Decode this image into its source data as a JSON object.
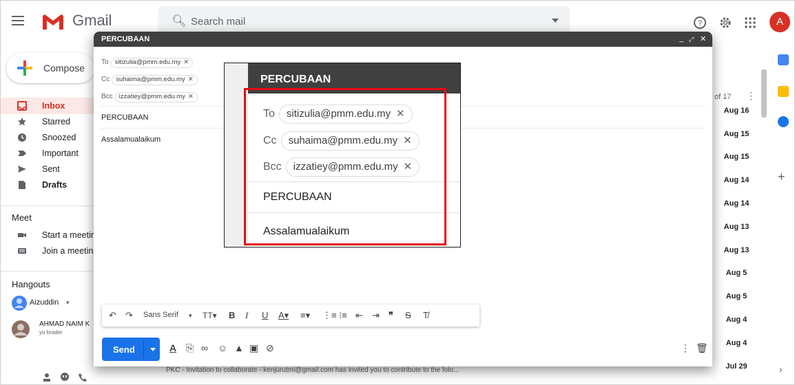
{
  "app": {
    "name": "Gmail"
  },
  "search": {
    "placeholder": "Search mail"
  },
  "user": {
    "avatar_letter": "A"
  },
  "sidebar": {
    "compose_label": "Compose",
    "items": [
      {
        "label": "Inbox",
        "icon": "inbox-icon"
      },
      {
        "label": "Starred",
        "icon": "star-icon"
      },
      {
        "label": "Snoozed",
        "icon": "clock-icon"
      },
      {
        "label": "Important",
        "icon": "important-icon"
      },
      {
        "label": "Sent",
        "icon": "send-icon"
      },
      {
        "label": "Drafts",
        "icon": "draft-icon"
      }
    ],
    "meet_title": "Meet",
    "meet_items": [
      "Start a meetin",
      "Join a meetin"
    ],
    "hangouts_title": "Hangouts",
    "hangouts_user": "Aizuddin",
    "contact_name": "AHMAD NAIM K",
    "contact_status": "yo brader"
  },
  "list": {
    "pager": "of 17",
    "dates": [
      "Aug 16",
      "Aug 15",
      "Aug 15",
      "Aug 14",
      "Aug 14",
      "Aug 13",
      "Aug 13",
      "Aug 5",
      "Aug 5",
      "Aug 4",
      "Aug 4",
      "Jul 29"
    ],
    "peek_text": "PKC - Invitation to collaborate - kenjurutmi@gmail.com has invited you to contribute to the folo..."
  },
  "compose": {
    "title": "PERCUBAAN",
    "to_label": "To",
    "cc_label": "Cc",
    "bcc_label": "Bcc",
    "to": "sitizulia@pmm.edu.my",
    "cc": "suhaima@pmm.edu.my",
    "bcc": "izzatiey@pmm.edu.my",
    "subject": "PERCUBAAN",
    "body": "Assalamualaikum",
    "font_select": "Sans Serif",
    "send_label": "Send"
  },
  "zoom": {
    "title": "PERCUBAAN",
    "to_label": "To",
    "cc_label": "Cc",
    "bcc_label": "Bcc",
    "to": "sitizulia@pmm.edu.my",
    "cc": "suhaima@pmm.edu.my",
    "bcc": "izzatiey@pmm.edu.my",
    "subject": "PERCUBAAN",
    "body": "Assalamualaikum",
    "highlight_color": "#e50914"
  },
  "colors": {
    "accent": "#1a73e8",
    "brand": "#d93025",
    "compose_header": "#404040"
  }
}
